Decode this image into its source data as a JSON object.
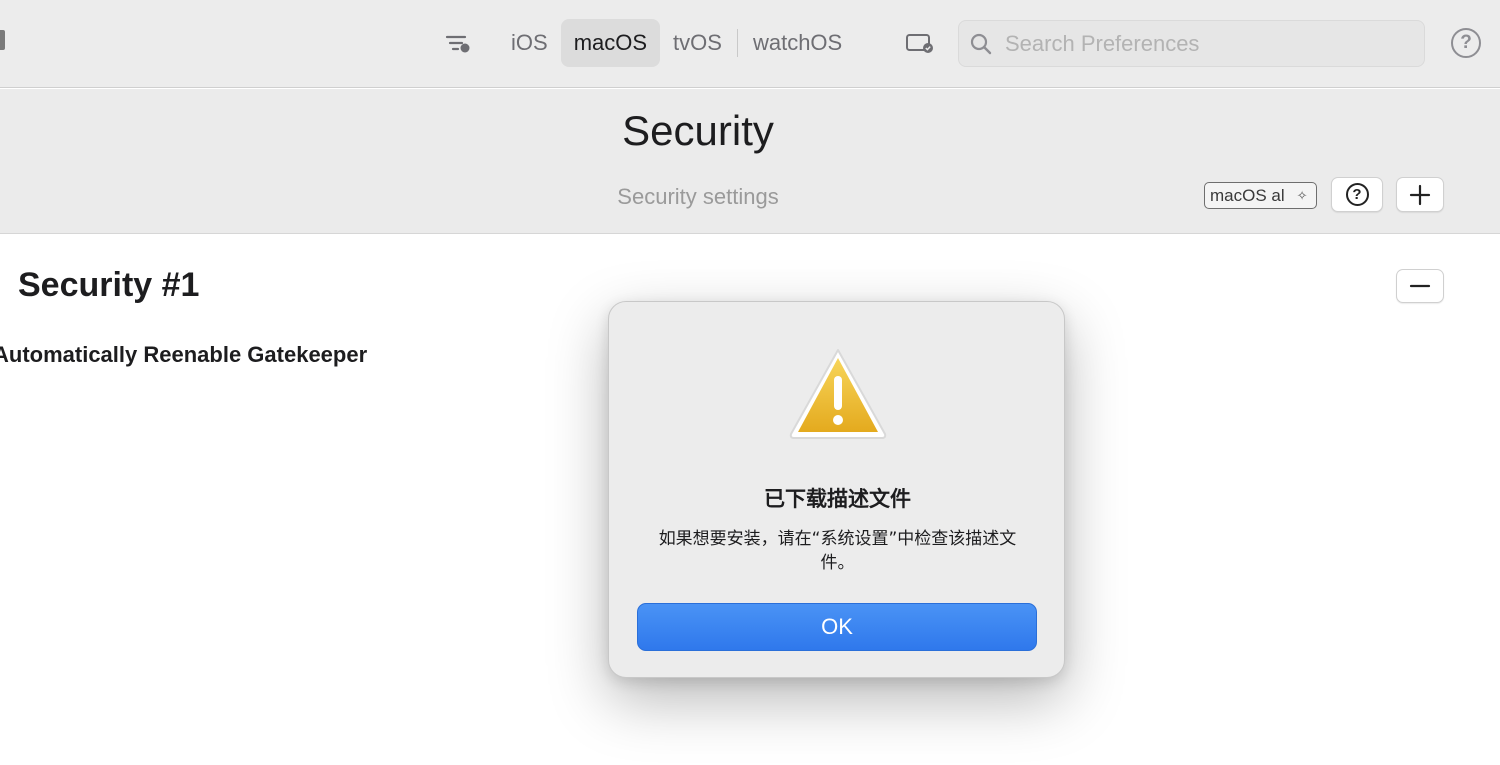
{
  "toolbar": {
    "platform_tabs": [
      {
        "label": "iOS",
        "active": false
      },
      {
        "label": "macOS",
        "active": true
      },
      {
        "label": "tvOS",
        "active": false
      },
      {
        "label": "watchOS",
        "active": false
      }
    ],
    "search_placeholder": "Search Preferences",
    "help_glyph": "?"
  },
  "header": {
    "title": "Security",
    "subtitle": "Security settings",
    "platform_badge": "macOS al",
    "help_glyph": "?",
    "add_glyph": "+"
  },
  "content": {
    "section_title": "Security #1",
    "setting_label": "Automatically Reenable Gatekeeper",
    "remove_glyph": "−"
  },
  "dialog": {
    "title": "已下载描述文件",
    "message": "如果想要安装，请在“系统设置”中检查该描述文件。",
    "ok_label": "OK"
  },
  "colors": {
    "accent": "#2f78ec",
    "toolbar_bg": "#ececec",
    "warning": "#f0c230"
  },
  "icons": [
    "filter-icon",
    "device-icon",
    "search-icon",
    "help-icon",
    "warning-icon",
    "plus-icon",
    "minus-icon",
    "sparkle-icon"
  ]
}
